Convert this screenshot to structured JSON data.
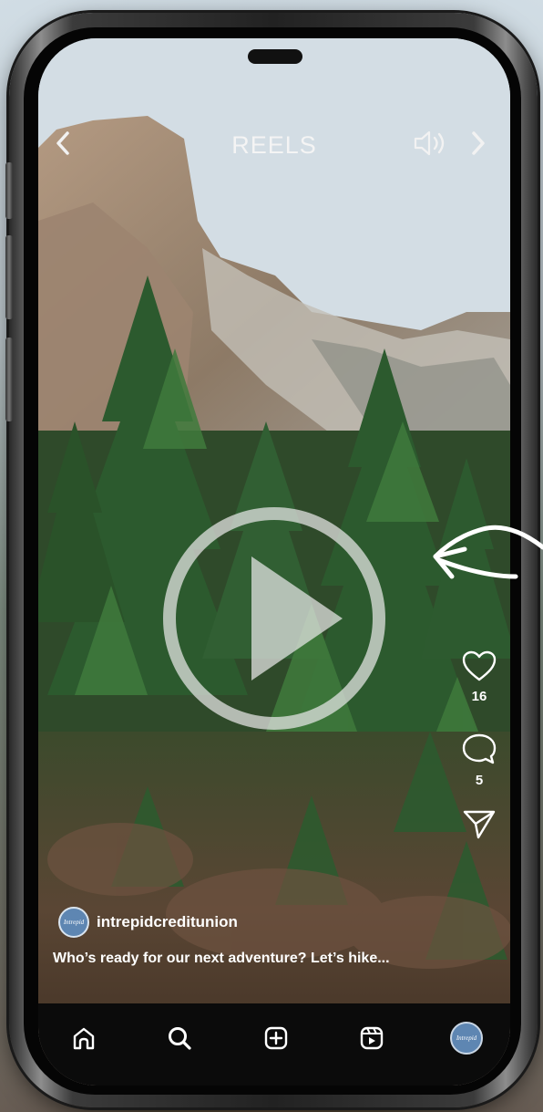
{
  "header": {
    "title": "REELS"
  },
  "actions": {
    "likes": "16",
    "comments": "5"
  },
  "post": {
    "username": "intrepidcreditunion",
    "caption": "Who’s ready for our next adventure? Let’s hike...",
    "avatar_text": "Intrepid"
  },
  "icons": {
    "back": "chevron-left-icon",
    "sound": "speaker-icon",
    "forward": "chevron-right-icon",
    "play": "play-icon",
    "like": "heart-icon",
    "comment": "comment-bubble-icon",
    "share": "send-icon",
    "nav": [
      "home-icon",
      "search-icon",
      "create-icon",
      "reels-icon",
      "profile-avatar"
    ]
  },
  "colors": {
    "avatar": "#5e86b2",
    "navbar": "#0b0b0b",
    "text": "#ffffff"
  }
}
